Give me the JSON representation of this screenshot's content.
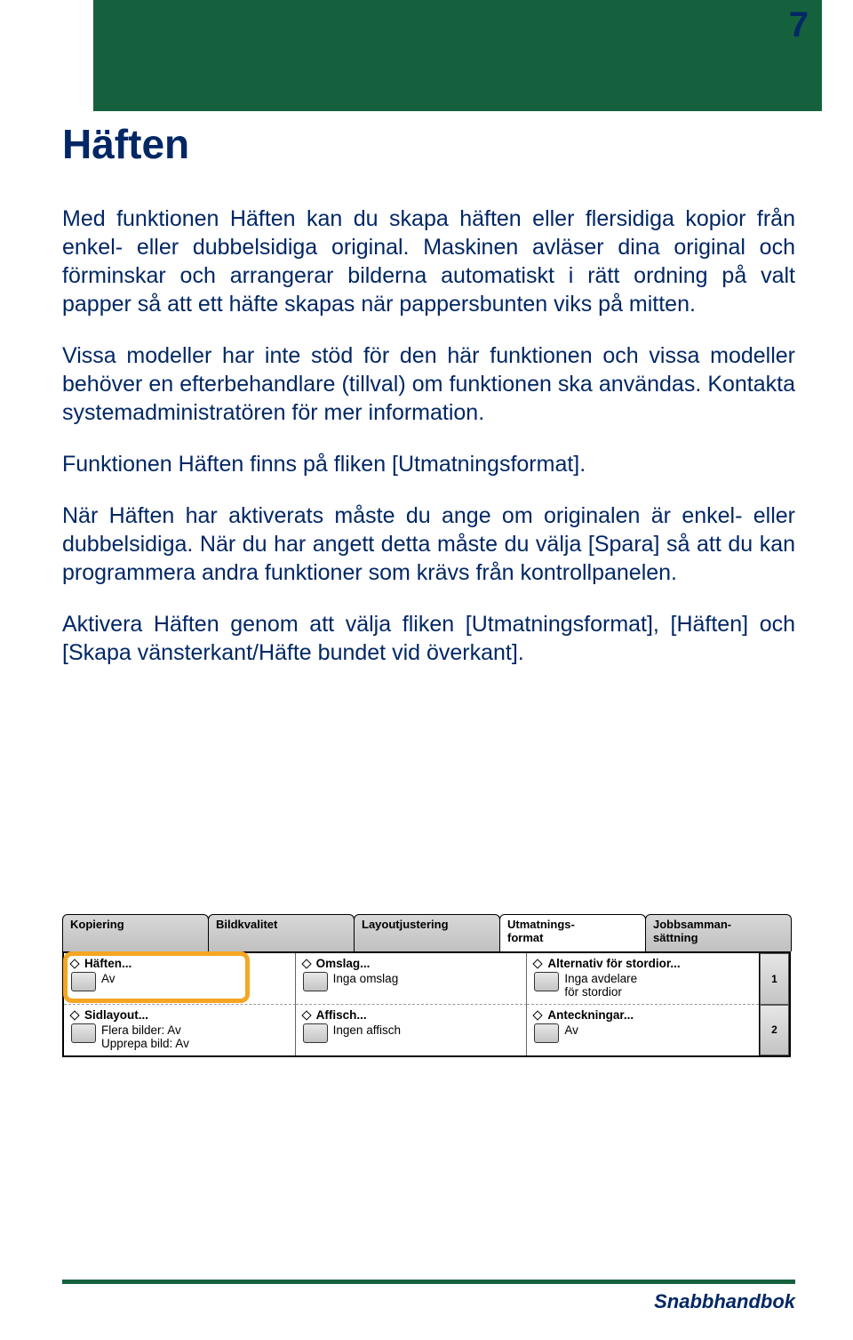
{
  "page_number": "7",
  "title": "Häften",
  "paragraphs": [
    "Med funktionen Häften kan du skapa häften eller flersidiga kopior från enkel- eller dubbelsidiga original. Maskinen avläser dina original och förminskar och arrangerar bilderna automatiskt i rätt ordning på valt papper så att ett häfte skapas när pappersbunten viks på mitten.",
    "Vissa modeller har inte stöd för den här funktionen och vissa modeller behöver en efterbehandlare (tillval) om funktionen ska användas. Kontakta systemadministratören för mer information.",
    "Funktionen Häften finns på fliken [Utmatningsformat].",
    "När Häften har aktiverats måste du ange om originalen är enkel- eller dubbelsidiga. När du har angett detta måste du välja [Spara] så att du kan programmera andra funktioner som krävs från kontrollpanelen.",
    "Aktivera Häften genom att välja fliken [Utmatningsformat], [Häften] och [Skapa vänsterkant/Häfte bundet vid överkant]."
  ],
  "ui": {
    "tabs": [
      "Kopiering",
      "Bildkvalitet",
      "Layoutjustering",
      "Utmatnings-\nformat",
      "Jobbsamman-\nsättning"
    ],
    "active_tab_index": 3,
    "row1": [
      {
        "title": "Häften...",
        "value": "Av"
      },
      {
        "title": "Omslag...",
        "value": "Inga omslag"
      },
      {
        "title": "Alternativ för stordior...",
        "value": "Inga avdelare\nför stordior"
      }
    ],
    "row2": [
      {
        "title": "Sidlayout...",
        "value": "Flera bilder: Av\nUpprepa bild: Av"
      },
      {
        "title": "Affisch...",
        "value": "Ingen affisch"
      },
      {
        "title": "Anteckningar...",
        "value": "Av"
      }
    ],
    "scroll": [
      "1",
      "2"
    ]
  },
  "footer": "Snabbhandbok"
}
